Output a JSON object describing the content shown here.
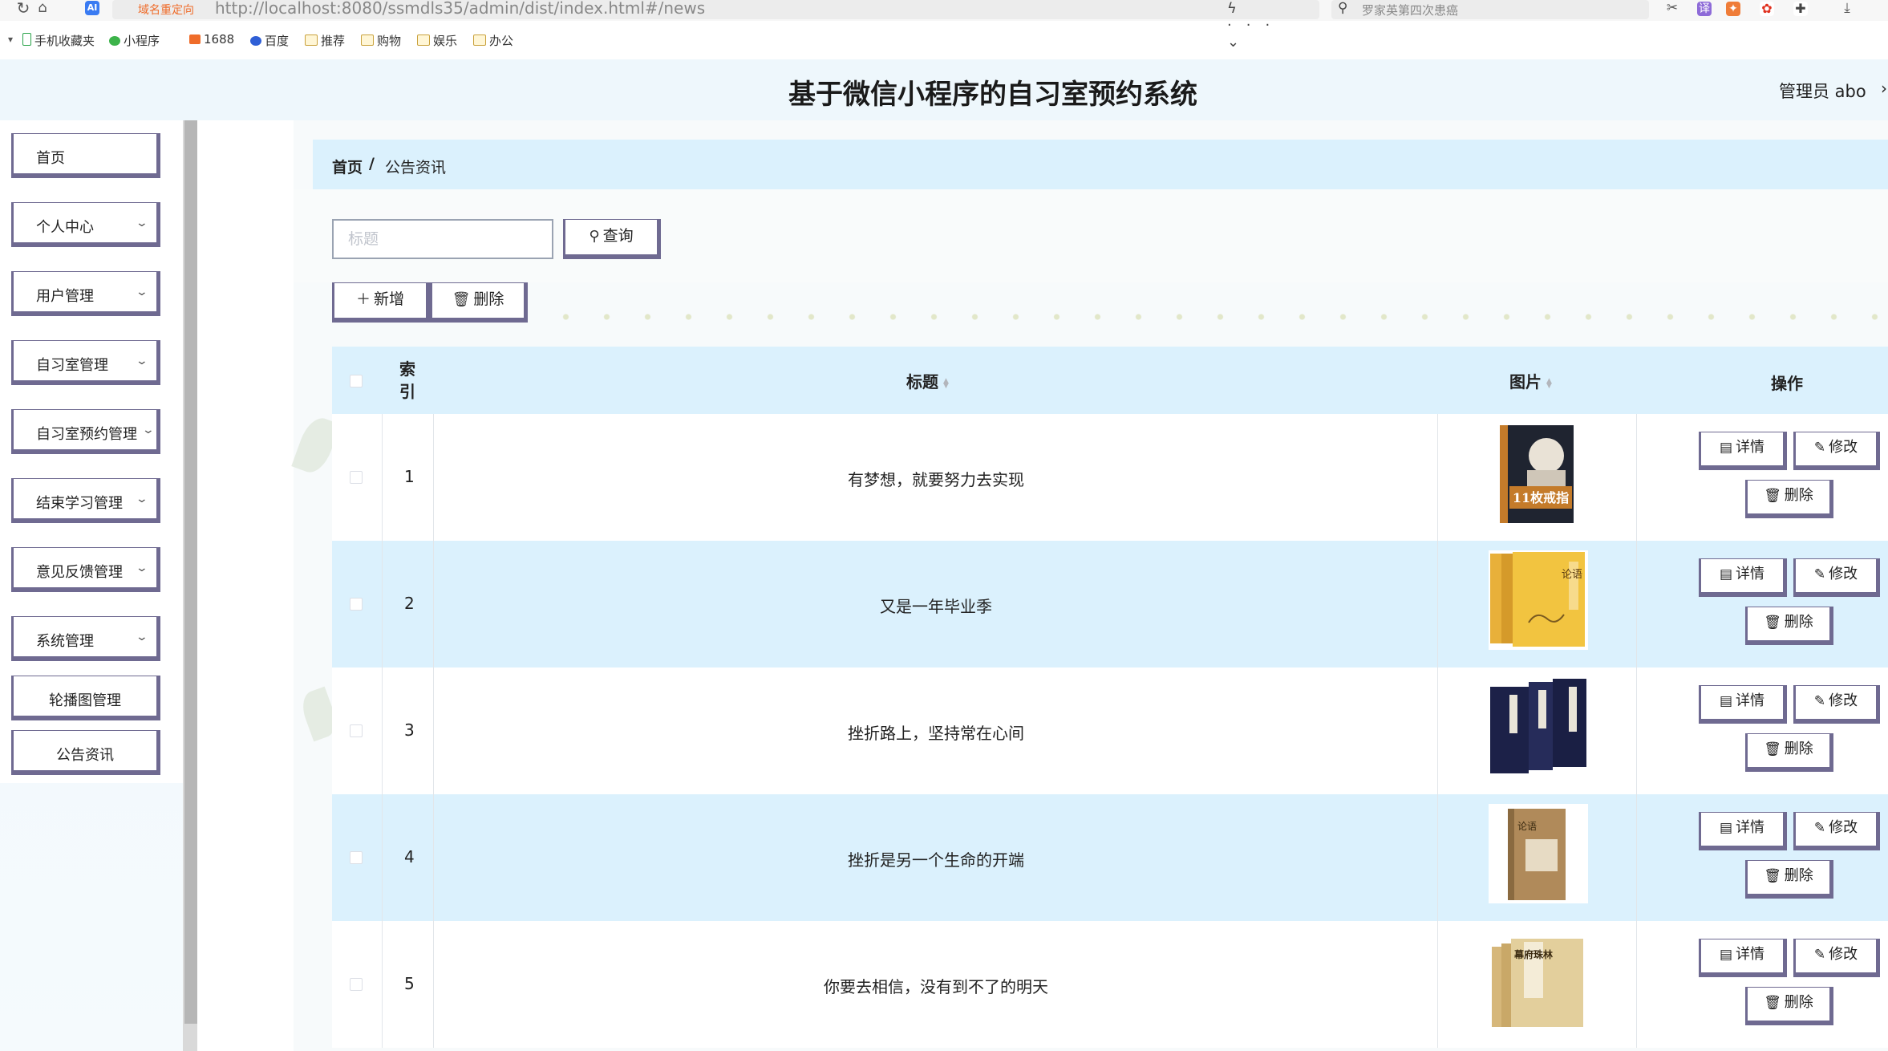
{
  "browser": {
    "url_tag": "域名重定向",
    "url": "http://localhost:8080/ssmdls35/admin/dist/index.html#/news",
    "tools": "ϟ ··· ⌄",
    "search_text": "罗家英第四次患癌",
    "ai_label": "AI",
    "bookmarks": [
      "手机收藏夹",
      "小程序",
      "1688",
      "百度",
      "推荐",
      "购物",
      "娱乐",
      "办公"
    ]
  },
  "header": {
    "system_title": "基于微信小程序的自习室预约系统",
    "admin_label": "管理员 abo"
  },
  "sidebar": {
    "items": [
      {
        "label": "首页",
        "expandable": false
      },
      {
        "label": "个人中心",
        "expandable": true
      },
      {
        "label": "用户管理",
        "expandable": true
      },
      {
        "label": "自习室管理",
        "expandable": true
      },
      {
        "label": "自习室预约管理",
        "expandable": true
      },
      {
        "label": "结束学习管理",
        "expandable": true
      },
      {
        "label": "意见反馈管理",
        "expandable": true
      },
      {
        "label": "系统管理",
        "expandable": true
      },
      {
        "label": "轮播图管理",
        "expandable": false
      },
      {
        "label": "公告资讯",
        "expandable": false
      }
    ]
  },
  "breadcrumb": {
    "home": "首页",
    "separator": "/",
    "current": "公告资讯"
  },
  "search": {
    "title_placeholder": "标题",
    "query_button": "查询"
  },
  "toolbar": {
    "add_button": "新增",
    "delete_button": "删除"
  },
  "table": {
    "columns": {
      "index": "索\n引",
      "title": "标题",
      "image": "图片",
      "actions": "操作"
    },
    "action_labels": {
      "detail": "详情",
      "edit": "修改",
      "delete": "删除"
    },
    "rows": [
      {
        "index": "1",
        "title": "有梦想，就要努力去实现",
        "image": "book-cover-11-rules",
        "cover_text": "11枚戒指"
      },
      {
        "index": "2",
        "title": "又是一年毕业季",
        "image": "book-cover-lunyu-yellow",
        "cover_text": "论语"
      },
      {
        "index": "3",
        "title": "挫折路上，坚持常在心间",
        "image": "book-cover-navy-set",
        "cover_text": ""
      },
      {
        "index": "4",
        "title": "挫折是另一个生命的开端",
        "image": "book-cover-lunyu-brown",
        "cover_text": "论语"
      },
      {
        "index": "5",
        "title": "你要去相信，没有到不了的明天",
        "image": "book-cover-mufu-zhulin",
        "cover_text": "幕府珠林"
      }
    ]
  },
  "colors": {
    "accent_border": "#6f6a91",
    "header_row_bg": "#dbf1fd",
    "breadcrumb_bg": "#dbf1fd"
  }
}
